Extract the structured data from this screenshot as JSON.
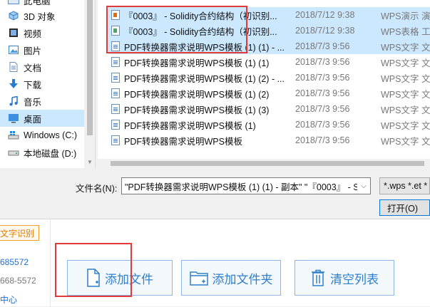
{
  "nav": {
    "items": [
      {
        "label": "此电脑",
        "icon": "computer-icon"
      },
      {
        "label": "3D 对象",
        "icon": "3d-objects-icon"
      },
      {
        "label": "视频",
        "icon": "video-icon"
      },
      {
        "label": "图片",
        "icon": "pictures-icon"
      },
      {
        "label": "文档",
        "icon": "documents-icon"
      },
      {
        "label": "下载",
        "icon": "download-icon"
      },
      {
        "label": "音乐",
        "icon": "music-icon"
      },
      {
        "label": "桌面",
        "icon": "desktop-icon"
      },
      {
        "label": "Windows (C:)",
        "icon": "drive-icon"
      },
      {
        "label": "本地磁盘 (D:)",
        "icon": "drive-icon"
      }
    ],
    "selected": "桌面"
  },
  "files": [
    {
      "name": "『0003』 - Solidity合约结构（初识别...",
      "date": "2018/7/12 9:38",
      "type": "WPS演示 演",
      "icon": "wpp",
      "selected": true
    },
    {
      "name": "『0003』 - Solidity合约结构（初识别...",
      "date": "2018/7/12 9:38",
      "type": "WPS表格 工",
      "icon": "et",
      "selected": true
    },
    {
      "name": "PDF转换器需求说明WPS模板 (1) (1) - ...",
      "date": "2018/7/3 9:56",
      "type": "WPS文字 文",
      "icon": "wps",
      "selected": true
    },
    {
      "name": "PDF转换器需求说明WPS模板 (1) (1)",
      "date": "2018/7/3 9:56",
      "type": "WPS文字 文",
      "icon": "wps",
      "selected": false
    },
    {
      "name": "PDF转换器需求说明WPS模板 (1) (2) - ...",
      "date": "2018/7/3 9:56",
      "type": "WPS文字 文",
      "icon": "wps",
      "selected": false
    },
    {
      "name": "PDF转换器需求说明WPS模板 (1) (2)",
      "date": "2018/7/3 9:56",
      "type": "WPS文字 文",
      "icon": "wps",
      "selected": false
    },
    {
      "name": "PDF转换器需求说明WPS模板 (1) (3)",
      "date": "2018/7/3 9:56",
      "type": "WPS文字 文",
      "icon": "wps",
      "selected": false
    },
    {
      "name": "PDF转换器需求说明WPS模板 (1)",
      "date": "2018/7/3 9:56",
      "type": "WPS文字 文",
      "icon": "wps",
      "selected": false
    },
    {
      "name": "PDF转换器需求说明WPS模板",
      "date": "2018/7/3 9:56",
      "type": "WPS文字 文",
      "icon": "wps",
      "selected": false
    }
  ],
  "filename": {
    "label": "文件名(N):",
    "value": "\"PDF转换器需求说明WPS模板 (1) (1) - 副本\" \"『0003』 - S"
  },
  "filetype": {
    "value": "*.wps *.et *"
  },
  "open_button": {
    "label": "打开(O)"
  },
  "sidebar": {
    "tab": "文字识别",
    "links": [
      {
        "text": "685572",
        "color": "#1e6fd0"
      },
      {
        "text": "668-5572",
        "color": "#777777"
      },
      {
        "text": "中心",
        "color": "#1e6fd0"
      }
    ]
  },
  "actions": {
    "add_file": "添加文件",
    "add_folder": "添加文件夹",
    "clear_list": "清空列表"
  },
  "colors": {
    "highlight": "#e03a3a",
    "selection": "#cce8ff",
    "accent": "#2f7fcc"
  }
}
